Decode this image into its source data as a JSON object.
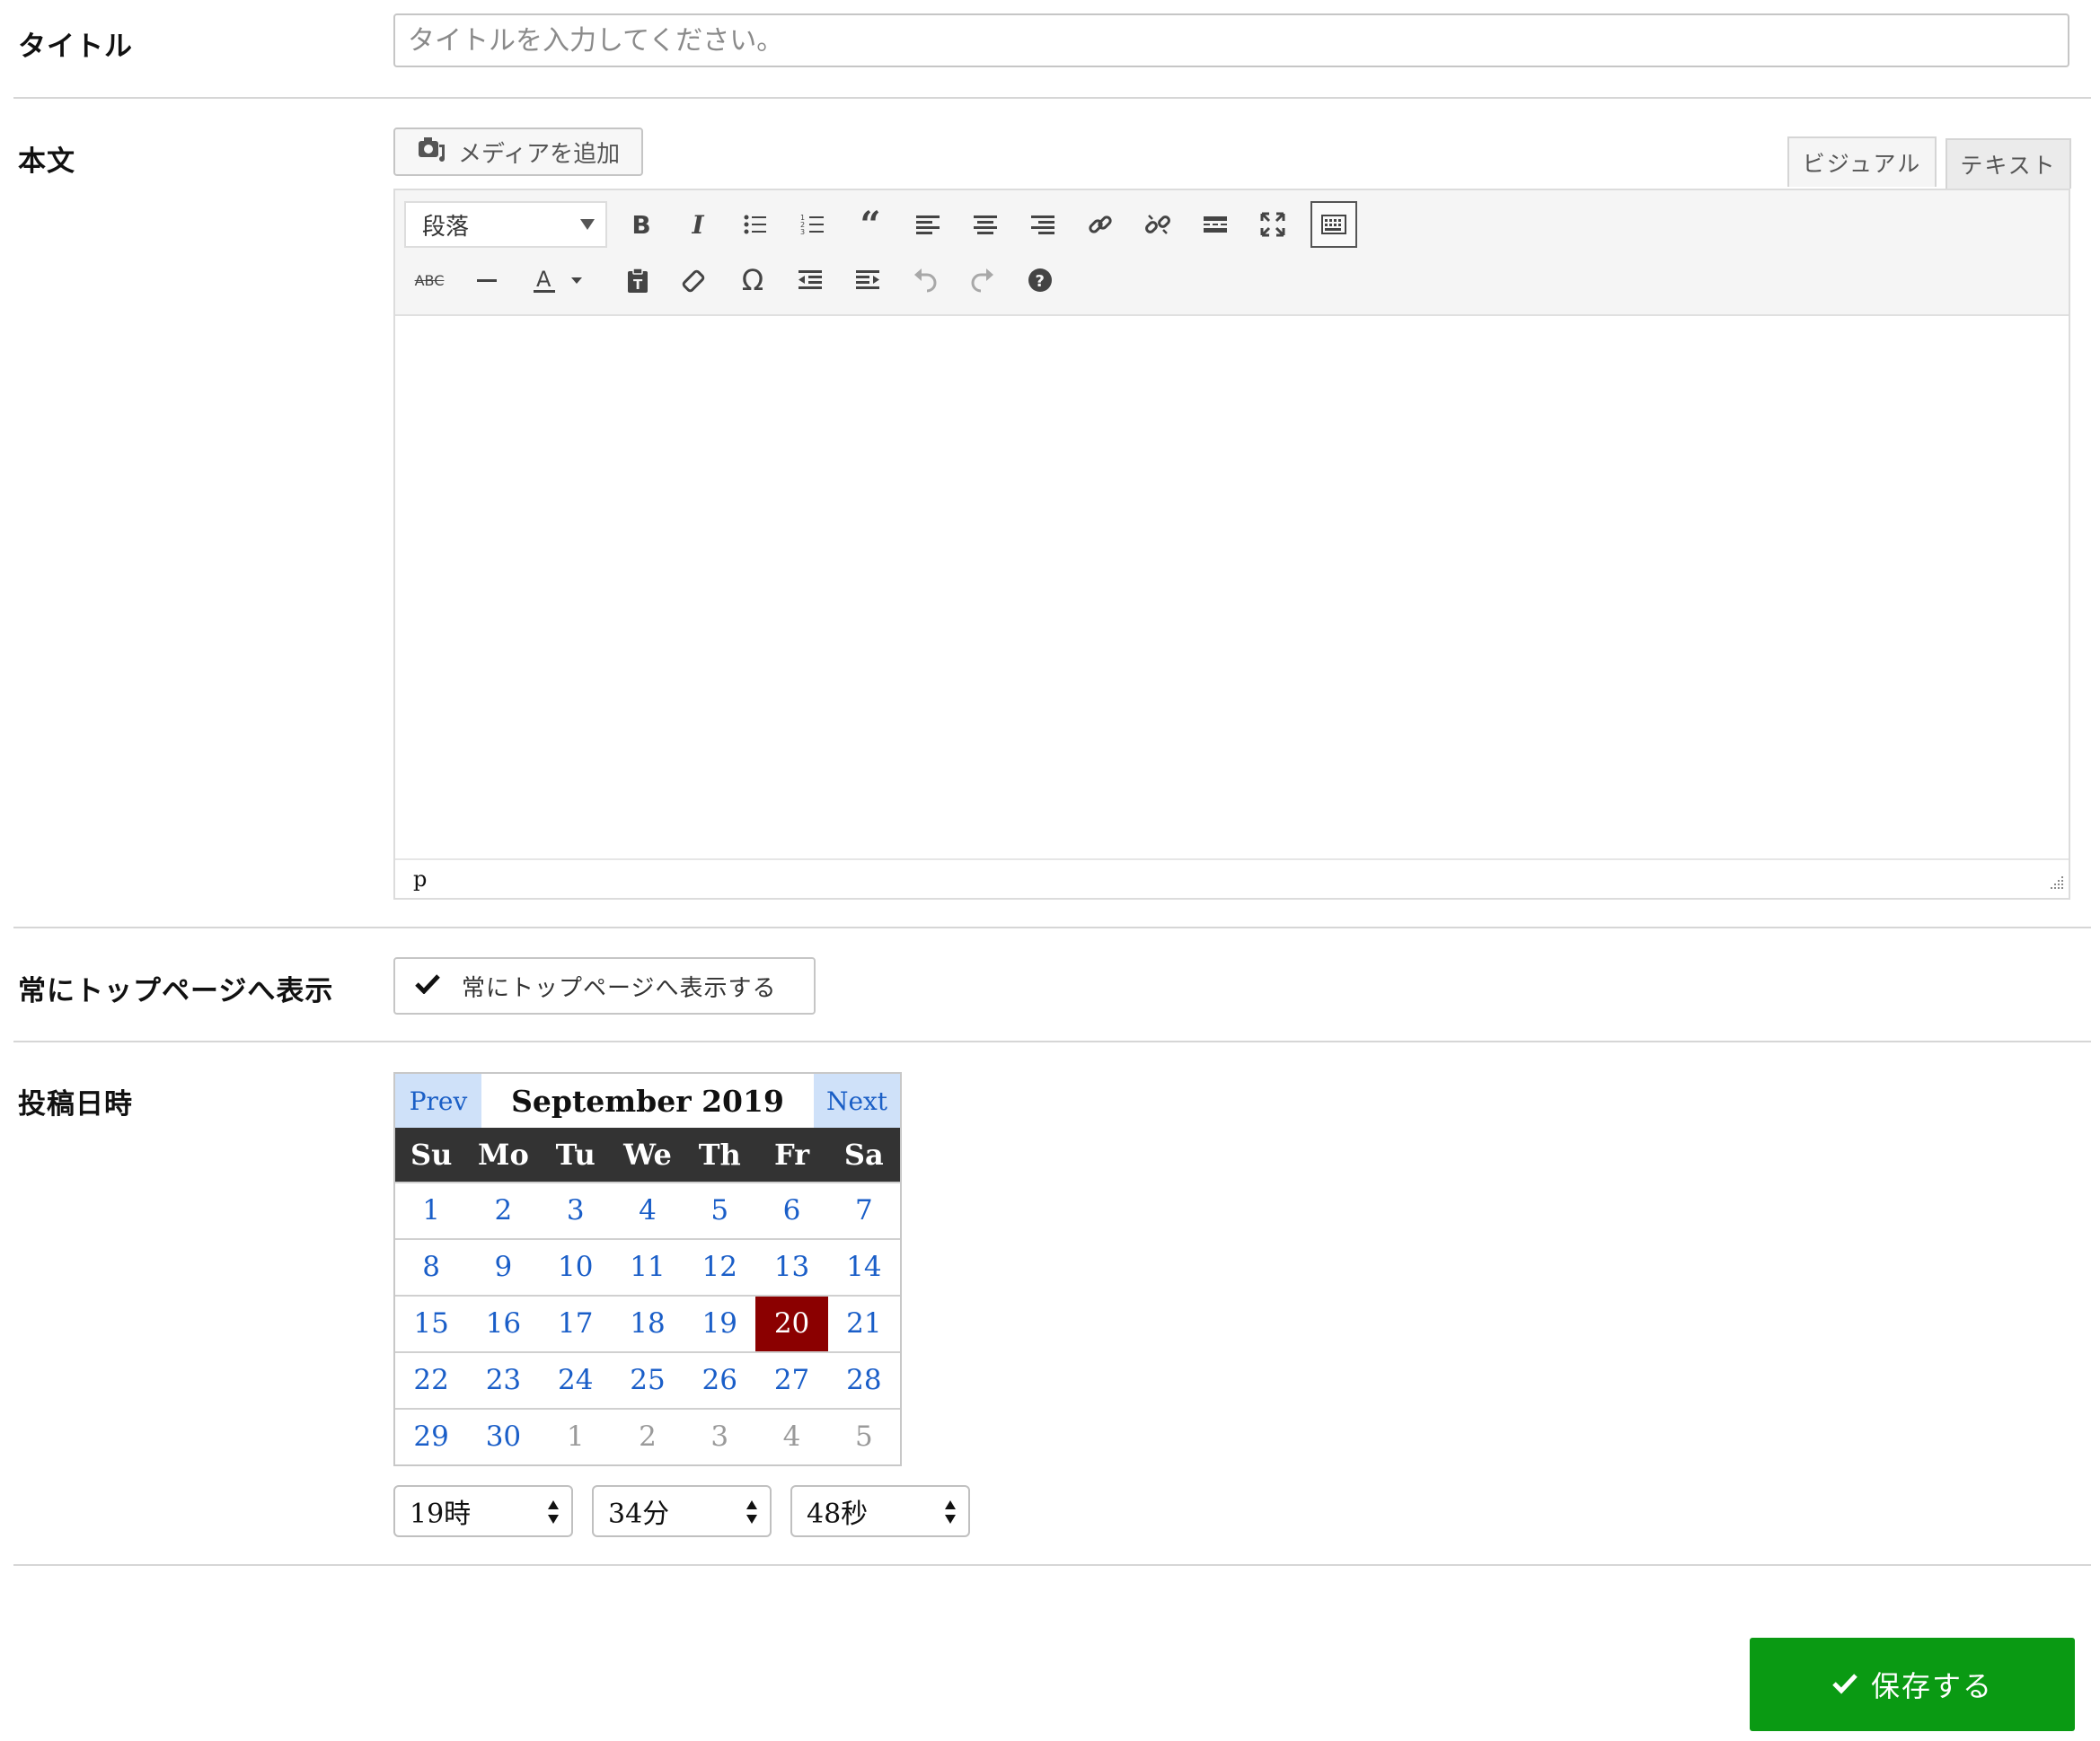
{
  "title_field": {
    "label": "タイトル",
    "placeholder": "タイトルを入力してください。",
    "value": ""
  },
  "body_field": {
    "label": "本文",
    "media_button": "メディアを追加",
    "tabs": [
      "ビジュアル",
      "テキスト"
    ],
    "active_tab": "ビジュアル",
    "format_select": "段落",
    "status_path": "p"
  },
  "top_page": {
    "label": "常にトップページへ表示",
    "checkbox_label": "常にトップページへ表示する",
    "checked": true
  },
  "post_date": {
    "label": "投稿日時",
    "calendar": {
      "prev": "Prev",
      "next": "Next",
      "month_title": "September 2019",
      "weekdays": [
        "Su",
        "Mo",
        "Tu",
        "We",
        "Th",
        "Fr",
        "Sa"
      ],
      "weeks": [
        [
          "1",
          "2",
          "3",
          "4",
          "5",
          "6",
          "7"
        ],
        [
          "8",
          "9",
          "10",
          "11",
          "12",
          "13",
          "14"
        ],
        [
          "15",
          "16",
          "17",
          "18",
          "19",
          "20",
          "21"
        ],
        [
          "22",
          "23",
          "24",
          "25",
          "26",
          "27",
          "28"
        ],
        [
          "29",
          "30",
          "1",
          "2",
          "3",
          "4",
          "5"
        ]
      ],
      "selected_day": "20"
    },
    "hour": "19時",
    "minute": "34分",
    "second": "48秒"
  },
  "save_button": "保存する",
  "colors": {
    "save": "#0a9a13",
    "selected_day": "#8b0000",
    "link": "#1a5ec8",
    "nav_bg": "#cfe1f9"
  }
}
